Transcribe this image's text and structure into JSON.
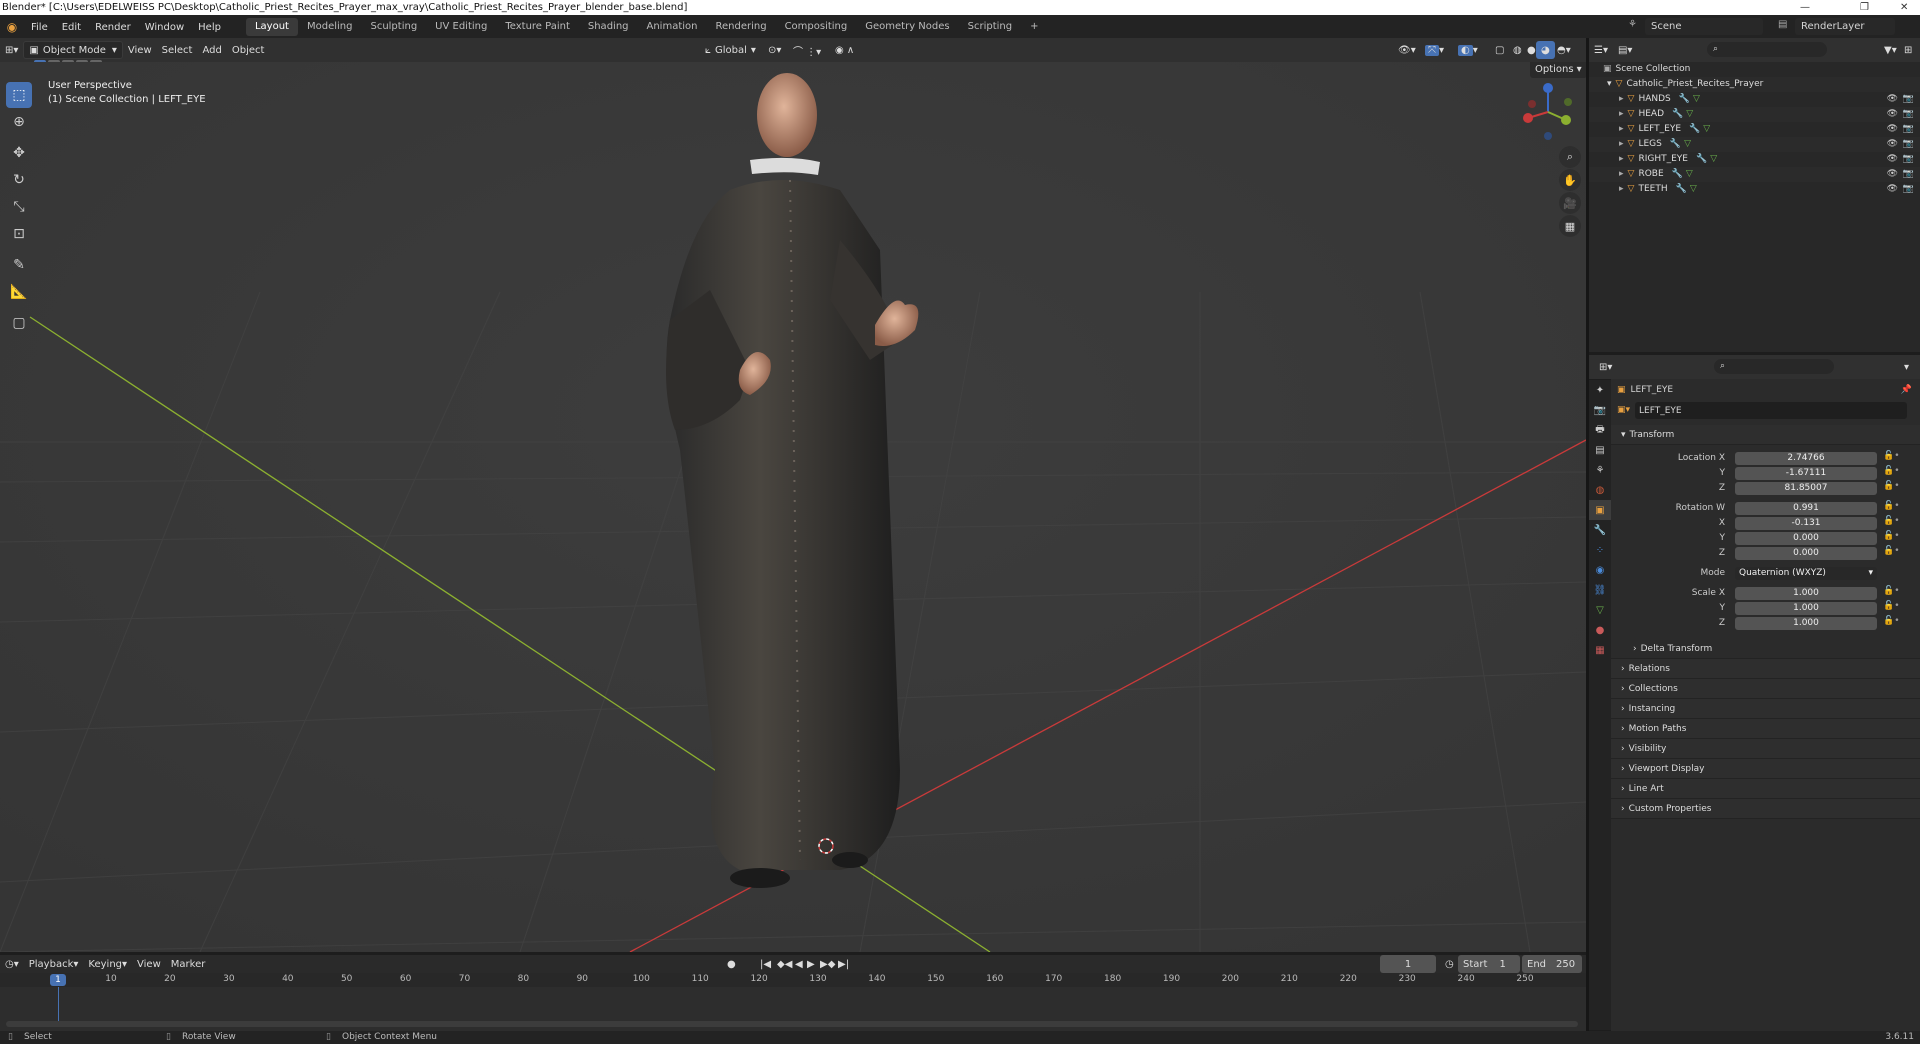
{
  "titlebar": {
    "text": "Blender* [C:\\Users\\EDELWEISS PC\\Desktop\\Catholic_Priest_Recites_Prayer_max_vray\\Catholic_Priest_Recites_Prayer_blender_base.blend]"
  },
  "menu": [
    "File",
    "Edit",
    "Render",
    "Window",
    "Help"
  ],
  "workspaces": [
    "Layout",
    "Modeling",
    "Sculpting",
    "UV Editing",
    "Texture Paint",
    "Shading",
    "Animation",
    "Rendering",
    "Compositing",
    "Geometry Nodes",
    "Scripting"
  ],
  "scene": {
    "name": "Scene",
    "view_layer": "RenderLayer"
  },
  "viewport_header": {
    "mode": "Object Mode",
    "view": "View",
    "select": "Select",
    "add": "Add",
    "object": "Object",
    "orientation": "Global",
    "options": "Options"
  },
  "viewport": {
    "perspective": "User Perspective",
    "collection_info": "(1) Scene Collection | LEFT_EYE"
  },
  "outliner": {
    "root": "Scene Collection",
    "collection": "Catholic_Priest_Recites_Prayer",
    "objects": [
      "HANDS",
      "HEAD",
      "LEFT_EYE",
      "LEGS",
      "RIGHT_EYE",
      "ROBE",
      "TEETH"
    ]
  },
  "properties": {
    "object_name": "LEFT_EYE",
    "data_name": "LEFT_EYE",
    "transform_label": "Transform",
    "location_label": "Location X",
    "location": [
      "2.74766",
      "-1.67111",
      "81.85007"
    ],
    "rotation_label": "Rotation W",
    "rotation": [
      "0.991",
      "-0.131",
      "0.000",
      "0.000"
    ],
    "mode_label": "Mode",
    "mode_value": "Quaternion (WXYZ)",
    "scale_label": "Scale X",
    "scale": [
      "1.000",
      "1.000",
      "1.000"
    ],
    "axis_y": "Y",
    "axis_z": "Z",
    "axis_x": "X",
    "delta": "Delta Transform",
    "sections": [
      "Relations",
      "Collections",
      "Instancing",
      "Motion Paths",
      "Visibility",
      "Viewport Display",
      "Line Art",
      "Custom Properties"
    ]
  },
  "timeline": {
    "menus": [
      "Playback",
      "Keying",
      "View",
      "Marker"
    ],
    "current_frame": "1",
    "start_label": "Start",
    "start": "1",
    "end_label": "End",
    "end": "250",
    "ticks": [
      "10",
      "20",
      "30",
      "40",
      "50",
      "60",
      "70",
      "80",
      "90",
      "100",
      "110",
      "120",
      "130",
      "140",
      "150",
      "160",
      "170",
      "180",
      "190",
      "200",
      "210",
      "220",
      "230",
      "240",
      "250"
    ],
    "playhead": "1"
  },
  "statusbar": {
    "select": "Select",
    "rotate": "Rotate View",
    "context": "Object Context Menu",
    "version": "3.6.11"
  },
  "colors": {
    "accent": "#4772b3",
    "x_axis": "#c93a3a",
    "y_axis": "#8cb030",
    "z_axis": "#3a6bc9",
    "orange": "#e8a040"
  }
}
